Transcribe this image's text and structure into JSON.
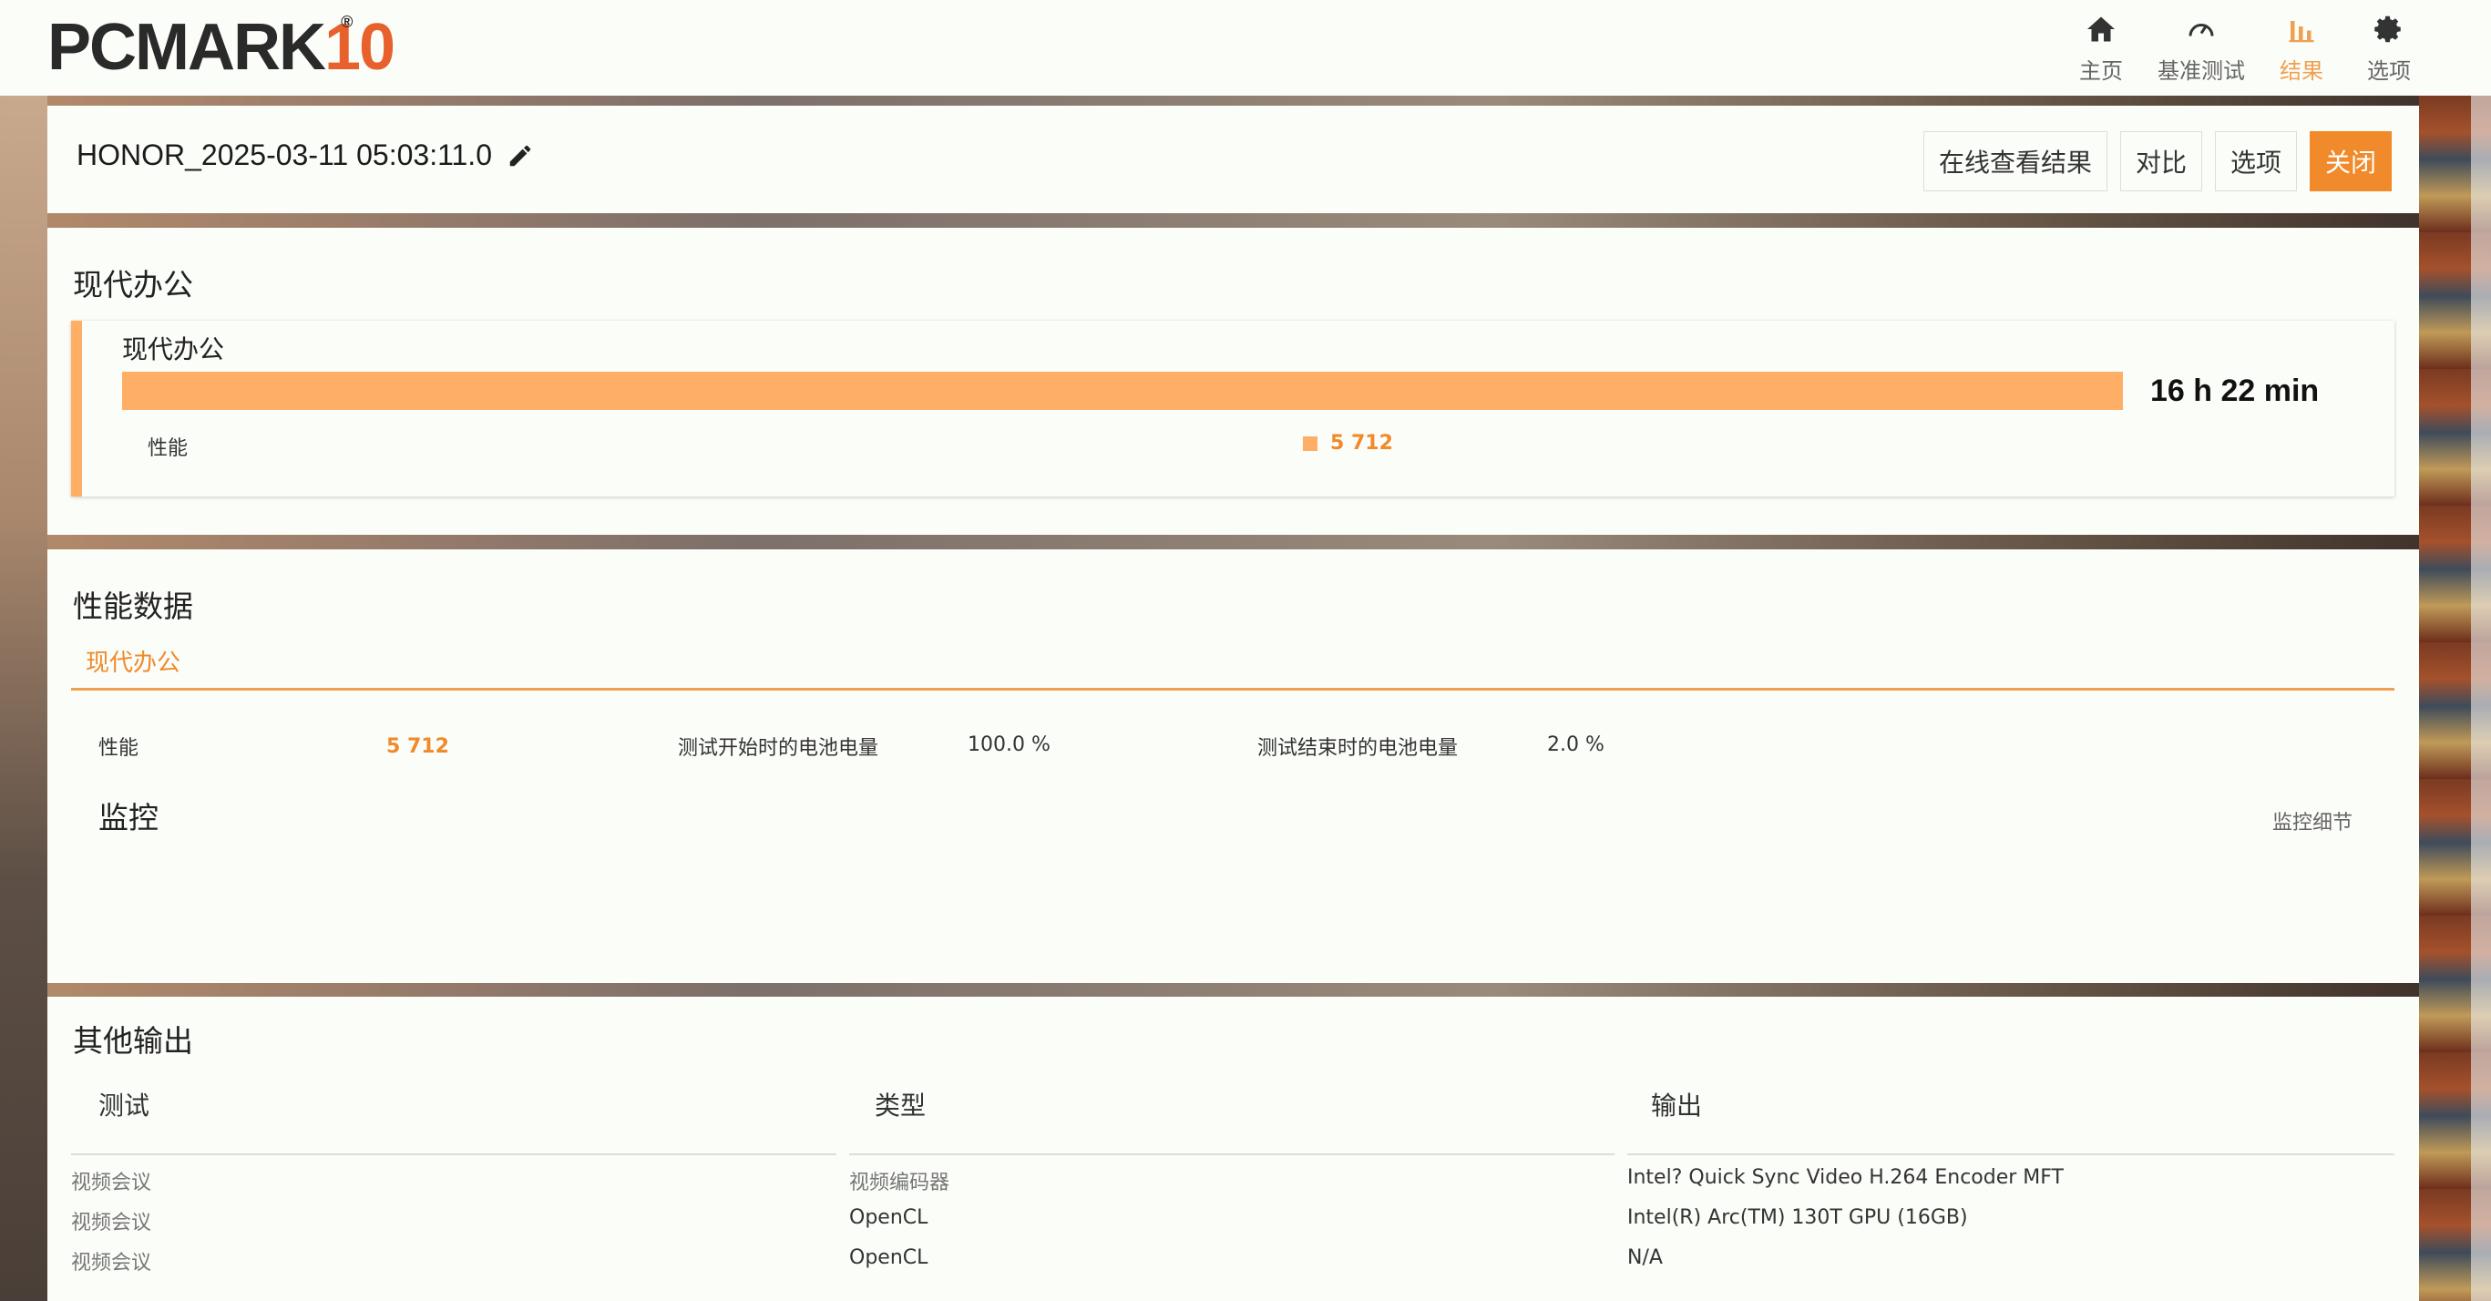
{
  "header": {
    "logo_main": "PCMARK",
    "logo_num": "10",
    "logo_reg": "®",
    "nav": [
      {
        "label": "主页",
        "icon": "home-icon"
      },
      {
        "label": "基准测试",
        "icon": "gauge-icon"
      },
      {
        "label": "结果",
        "icon": "bar-chart-icon",
        "active": true
      },
      {
        "label": "选项",
        "icon": "gear-icon"
      }
    ]
  },
  "result": {
    "name": "HONOR_2025-03-11 05:03:11.0",
    "buttons": {
      "view_online": "在线查看结果",
      "compare": "对比",
      "options": "选项",
      "close": "关闭"
    }
  },
  "modern_office": {
    "section_title": "现代办公",
    "card_title": "现代办公",
    "battery_life": "16 h 22 min",
    "bar_fill_fraction": 1.0,
    "perf_label": "性能",
    "perf_score": "5 712"
  },
  "perf_data": {
    "section_title": "性能数据",
    "tab": "现代办公",
    "perf_label": "性能",
    "perf_value": "5 712",
    "battery_start_label": "测试开始时的电池电量",
    "battery_start_value": "100.0 %",
    "battery_end_label": "测试结束时的电池电量",
    "battery_end_value": "2.0 %",
    "monitor_title": "监控",
    "monitor_details": "监控细节"
  },
  "other_output": {
    "section_title": "其他输出",
    "columns": [
      "测试",
      "类型",
      "输出"
    ],
    "rows": [
      [
        "视频会议",
        "视频编码器",
        "Intel? Quick Sync Video H.264 Encoder MFT"
      ],
      [
        "视频会议",
        "OpenCL",
        "Intel(R) Arc(TM) 130T GPU (16GB)"
      ],
      [
        "视频会议",
        "OpenCL",
        "N/A"
      ]
    ]
  },
  "colors": {
    "accent": "#f08a2a",
    "bar": "#ffae66"
  }
}
